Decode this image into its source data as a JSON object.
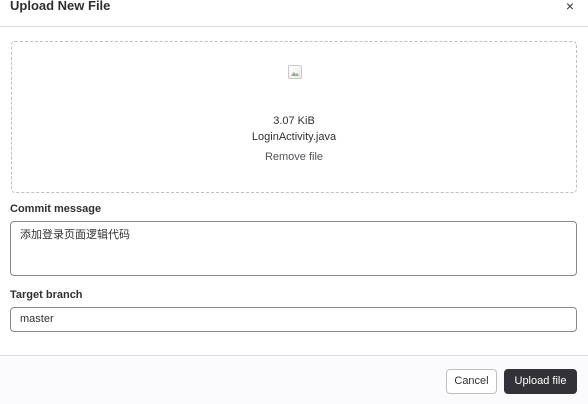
{
  "modal": {
    "title": "Upload New File",
    "close_glyph": "×"
  },
  "file": {
    "size": "3.07 KiB",
    "name": "LoginActivity.java",
    "remove_label": "Remove file",
    "preview_icon": "broken-image-icon"
  },
  "commit": {
    "label": "Commit message",
    "value": "添加登录页面逻辑代码"
  },
  "branch": {
    "label": "Target branch",
    "value": "master"
  },
  "footer": {
    "cancel_label": "Cancel",
    "upload_label": "Upload file"
  },
  "colors": {
    "primary_button": "#333238",
    "border": "#89888d",
    "dashed_border": "#bfbfc3",
    "text": "#303030"
  }
}
